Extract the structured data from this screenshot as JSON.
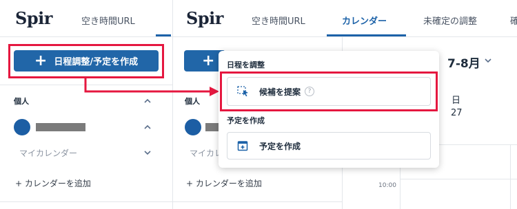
{
  "left_panel": {
    "logo": "Spir",
    "nav_free_url": "空き時間URL",
    "create_button_label": "日程調整/予定を作成",
    "section_title": "個人",
    "calendar_placeholder": "マイカレンダー",
    "add_calendar": "+ カレンダーを追加"
  },
  "right_panel": {
    "logo": "Spir",
    "nav_items": [
      "空き時間URL",
      "カレンダー",
      "未確定の調整",
      "確"
    ],
    "section_title": "個人",
    "calendar_placeholder": "マイカレ",
    "add_calendar": "+ カレンダーを追加"
  },
  "calendar": {
    "month_label": "7-8月",
    "day_name": "日",
    "day_number": "27",
    "time_label": "10:00"
  },
  "dropdown": {
    "schedule_heading": "日程を調整",
    "propose_label": "候補を提案",
    "help_mark": "?",
    "create_heading": "予定を作成",
    "create_label": "予定を作成"
  },
  "colors": {
    "brand_blue": "#1c62a8",
    "highlight_red": "#e5173f"
  }
}
